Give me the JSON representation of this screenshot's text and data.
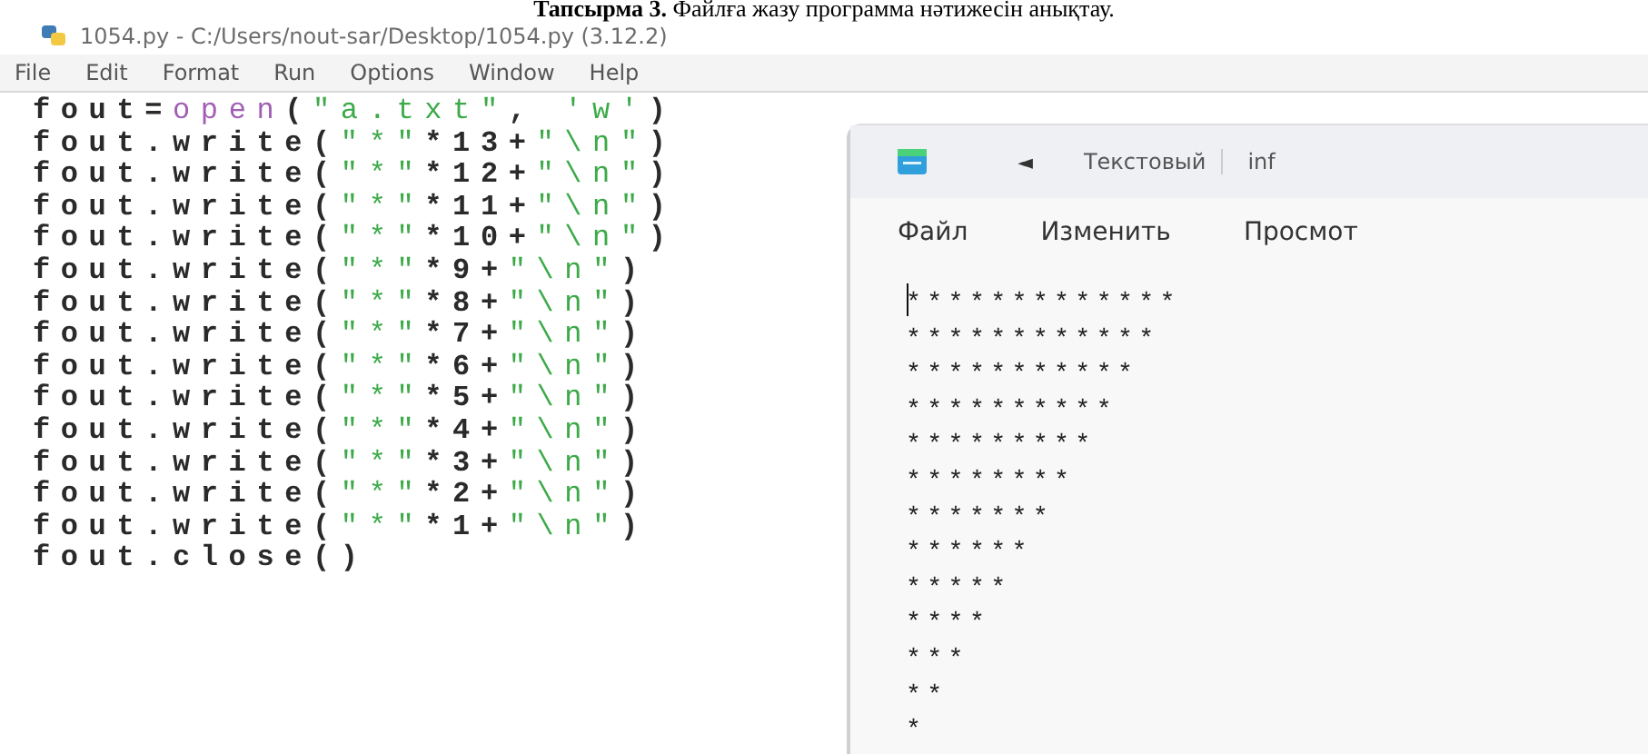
{
  "caption": {
    "label": "Тапсырма 3.",
    "text": "Файлға жазу программа нәтижесін анықтау."
  },
  "idle_window": {
    "title": "1054.py - C:/Users/nout-sar/Desktop/1054.py (3.12.2)",
    "menu": [
      "File",
      "Edit",
      "Format",
      "Run",
      "Options",
      "Window",
      "Help"
    ],
    "code_lines": [
      [
        {
          "kind": "plain",
          "text": "fout="
        },
        {
          "kind": "builtin",
          "text": "open"
        },
        {
          "kind": "plain",
          "text": "("
        },
        {
          "kind": "string",
          "text": "\"a.txt\""
        },
        {
          "kind": "plain",
          "text": ", "
        },
        {
          "kind": "string",
          "text": "'w'"
        },
        {
          "kind": "plain",
          "text": ")"
        }
      ],
      [
        {
          "kind": "plain",
          "text": "fout.write("
        },
        {
          "kind": "string",
          "text": "\"*\""
        },
        {
          "kind": "plain",
          "text": "*13+"
        },
        {
          "kind": "string",
          "text": "\"\\n\""
        },
        {
          "kind": "plain",
          "text": ")"
        }
      ],
      [
        {
          "kind": "plain",
          "text": "fout.write("
        },
        {
          "kind": "string",
          "text": "\"*\""
        },
        {
          "kind": "plain",
          "text": "*12+"
        },
        {
          "kind": "string",
          "text": "\"\\n\""
        },
        {
          "kind": "plain",
          "text": ")"
        }
      ],
      [
        {
          "kind": "plain",
          "text": "fout.write("
        },
        {
          "kind": "string",
          "text": "\"*\""
        },
        {
          "kind": "plain",
          "text": "*11+"
        },
        {
          "kind": "string",
          "text": "\"\\n\""
        },
        {
          "kind": "plain",
          "text": ")"
        }
      ],
      [
        {
          "kind": "plain",
          "text": "fout.write("
        },
        {
          "kind": "string",
          "text": "\"*\""
        },
        {
          "kind": "plain",
          "text": "*10+"
        },
        {
          "kind": "string",
          "text": "\"\\n\""
        },
        {
          "kind": "plain",
          "text": ")"
        }
      ],
      [
        {
          "kind": "plain",
          "text": "fout.write("
        },
        {
          "kind": "string",
          "text": "\"*\""
        },
        {
          "kind": "plain",
          "text": "*9+"
        },
        {
          "kind": "string",
          "text": "\"\\n\""
        },
        {
          "kind": "plain",
          "text": ")"
        }
      ],
      [
        {
          "kind": "plain",
          "text": "fout.write("
        },
        {
          "kind": "string",
          "text": "\"*\""
        },
        {
          "kind": "plain",
          "text": "*8+"
        },
        {
          "kind": "string",
          "text": "\"\\n\""
        },
        {
          "kind": "plain",
          "text": ")"
        }
      ],
      [
        {
          "kind": "plain",
          "text": "fout.write("
        },
        {
          "kind": "string",
          "text": "\"*\""
        },
        {
          "kind": "plain",
          "text": "*7+"
        },
        {
          "kind": "string",
          "text": "\"\\n\""
        },
        {
          "kind": "plain",
          "text": ")"
        }
      ],
      [
        {
          "kind": "plain",
          "text": "fout.write("
        },
        {
          "kind": "string",
          "text": "\"*\""
        },
        {
          "kind": "plain",
          "text": "*6+"
        },
        {
          "kind": "string",
          "text": "\"\\n\""
        },
        {
          "kind": "plain",
          "text": ")"
        }
      ],
      [
        {
          "kind": "plain",
          "text": "fout.write("
        },
        {
          "kind": "string",
          "text": "\"*\""
        },
        {
          "kind": "plain",
          "text": "*5+"
        },
        {
          "kind": "string",
          "text": "\"\\n\""
        },
        {
          "kind": "plain",
          "text": ")"
        }
      ],
      [
        {
          "kind": "plain",
          "text": "fout.write("
        },
        {
          "kind": "string",
          "text": "\"*\""
        },
        {
          "kind": "plain",
          "text": "*4+"
        },
        {
          "kind": "string",
          "text": "\"\\n\""
        },
        {
          "kind": "plain",
          "text": ")"
        }
      ],
      [
        {
          "kind": "plain",
          "text": "fout.write("
        },
        {
          "kind": "string",
          "text": "\"*\""
        },
        {
          "kind": "plain",
          "text": "*3+"
        },
        {
          "kind": "string",
          "text": "\"\\n\""
        },
        {
          "kind": "plain",
          "text": ")"
        }
      ],
      [
        {
          "kind": "plain",
          "text": "fout.write("
        },
        {
          "kind": "string",
          "text": "\"*\""
        },
        {
          "kind": "plain",
          "text": "*2+"
        },
        {
          "kind": "string",
          "text": "\"\\n\""
        },
        {
          "kind": "plain",
          "text": ")"
        }
      ],
      [
        {
          "kind": "plain",
          "text": "fout.write("
        },
        {
          "kind": "string",
          "text": "\"*\""
        },
        {
          "kind": "plain",
          "text": "*1+"
        },
        {
          "kind": "string",
          "text": "\"\\n\""
        },
        {
          "kind": "plain",
          "text": ")"
        }
      ],
      [
        {
          "kind": "plain",
          "text": "fout.close()"
        }
      ]
    ]
  },
  "notepad_window": {
    "back": "◄",
    "tab_title": "Текстовый",
    "tab_file": "inf",
    "menu": [
      "Файл",
      "Изменить",
      "Просмот"
    ],
    "text": "*************\n************\n***********\n**********\n*********\n********\n*******\n******\n*****\n****\n***\n**\n*"
  }
}
